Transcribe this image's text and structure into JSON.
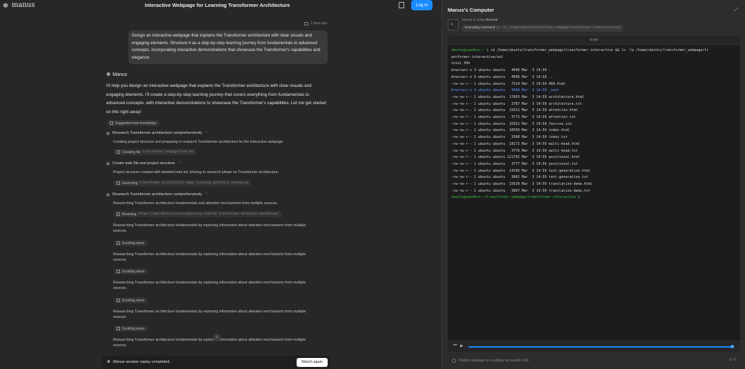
{
  "app": {
    "name": "manus",
    "page_title": "Interactive Webpage for Learning Transformer Architecture",
    "login_label": "Log in"
  },
  "chat": {
    "timestamp": "2 days ago",
    "user_message": "Design an interactive webpage that explains the Transformer architecture with clear visuals and engaging elements. Structure it as a step-by-step learning journey from fundamentals to advanced concepts, incorporating interactive demonstrations that showcase the Transformer's capabilities and elegance.",
    "assistant_name": "Manus",
    "assistant_reply": "I'll help you design an interactive webpage that explains the Transformer architecture with clear visuals and engaging elements. I'll create a step-by-step learning journey that covers everything from fundamentals to advanced concepts, with interactive demonstrations to showcase the Transformer's capabilities. Let me get started on this right away!",
    "knowledge_pill": "Suggested new knowledge",
    "steps": [
      {
        "title": "Research Transformer architecture comprehensively",
        "desc": "Creating project structure and preparing to research Transformer architecture for the interactive webpage.",
        "action": "Creating file",
        "arg": "transformer_webpage/todo.md"
      },
      {
        "title": "Create todo file and project structure",
        "desc": "Project structure created with detailed todo list. Moving to research phase on Transformer architecture.",
        "action": "Searching",
        "arg": "transformer architecture deep learning attention mechanism"
      },
      {
        "title": "Research Transformer architecture comprehensively",
        "desc": "Researching Transformer architecture fundamentals and attention mechanisms from multiple sources.",
        "action": "Browsing",
        "arg": "https://www.machinelearningmastery.com/the-transformer-attention-mechanism/"
      }
    ],
    "repeat_desc": "Researching Transformer architecture fundamentals by exploring information about attention mechanisms from multiple sources.",
    "scroll_label": "Scrolling down",
    "replay_text": "Manus session replay completed.",
    "watch_again": "Watch again"
  },
  "computer": {
    "title": "Manus's Computer",
    "using_prefix": "Manus is using",
    "using_tool": "Terminal",
    "executing_label": "Executing command",
    "command": "ls -la /home/ubuntu/transformer_webpage/transformer-interactive/out",
    "terminal_tab": "shell4",
    "prompt1": "ubuntu@sandbox:~ $",
    "cmd_line": "cd /home/ubuntu/transformer_webpage/transformer-interactive && ls -la /home/ubuntu/transformer_webpage/tr",
    "cmd_line2": "ansformer-interactive/out",
    "total": "total 304",
    "listing": [
      "drwxrwxr-x 3 ubuntu ubuntu   4096 Mar  3 14:59 .",
      "drwxrwxr-x 9 ubuntu ubuntu   4096 Mar  3 14:59 ..",
      "-rw-rw-r-- 1 ubuntu ubuntu   7524 Mar  3 14:59 404.html",
      "drwxrwxr-x 4 ubuntu ubuntu   4096 Mar  3 14:59 _next",
      "-rw-rw-r-- 1 ubuntu ubuntu  17603 Mar  3 14:59 architecture.html",
      "-rw-rw-r-- 1 ubuntu ubuntu   3787 Mar  3 14:59 architecture.txt",
      "-rw-rw-r-- 1 ubuntu ubuntu  15911 Mar  3 14:59 attention.html",
      "-rw-rw-r-- 1 ubuntu ubuntu   3772 Mar  3 14:59 attention.txt",
      "-rw-rw-r-- 1 ubuntu ubuntu  25931 Mar  3 14:59 favicon.ico",
      "-rw-rw-r-- 1 ubuntu ubuntu  10550 Mar  3 14:59 index.html",
      "-rw-rw-r-- 1 ubuntu ubuntu   3308 Mar  3 14:59 index.txt",
      "-rw-rw-r-- 1 ubuntu ubuntu  18172 Mar  3 14:59 multi-head.html",
      "-rw-rw-r-- 1 ubuntu ubuntu   3776 Mar  3 14:59 multi-head.txt",
      "-rw-rw-r-- 1 ubuntu ubuntu 121765 Mar  3 14:59 positional.html",
      "-rw-rw-r-- 1 ubuntu ubuntu   3777 Mar  3 14:59 positional.txt",
      "-rw-rw-r-- 1 ubuntu ubuntu  14166 Mar  3 14:59 text-generation.html",
      "-rw-rw-r-- 1 ubuntu ubuntu   3802 Mar  3 14:59 text-generation.txt",
      "-rw-rw-r-- 1 ubuntu ubuntu  15639 Mar  3 14:59 translation-demo.html",
      "-rw-rw-r-- 1 ubuntu ubuntu   3807 Mar  3 14:59 translation-demo.txt"
    ],
    "prompt2": "ubuntu@sandbox:~/transformer_webpage/transformer-interactive $",
    "status_text": "Publish webpage to a publicly accessible URL",
    "page_count": "6 / 6"
  }
}
